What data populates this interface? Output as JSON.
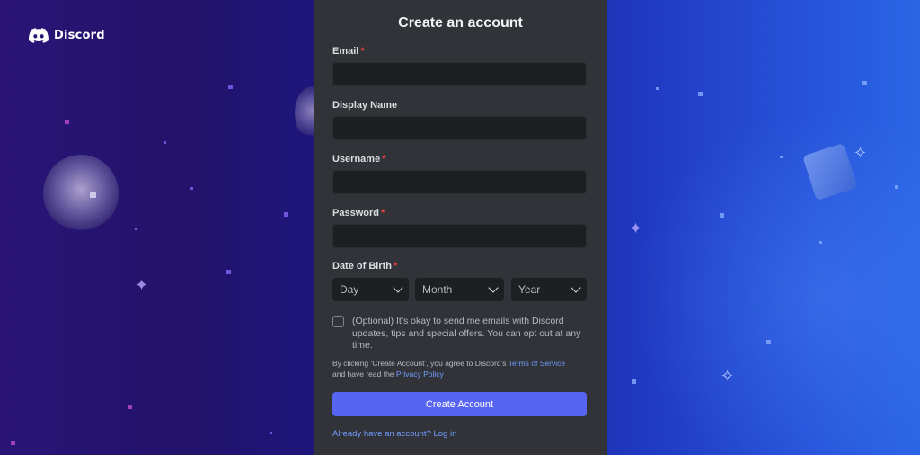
{
  "brand": {
    "name": "Discord",
    "logo_icon": "discord-clyde-icon"
  },
  "form": {
    "title": "Create an account",
    "email": {
      "label": "Email",
      "required_marker": "*",
      "value": ""
    },
    "display_name": {
      "label": "Display Name",
      "value": ""
    },
    "username": {
      "label": "Username",
      "required_marker": "*",
      "value": ""
    },
    "password": {
      "label": "Password",
      "required_marker": "*",
      "value": ""
    },
    "dob": {
      "label": "Date of Birth",
      "required_marker": "*",
      "day": "Day",
      "month": "Month",
      "year": "Year"
    },
    "optin": {
      "checked": false,
      "text": "(Optional) It’s okay to send me emails with Discord updates, tips and special offers. You can opt out at any time."
    },
    "terms": {
      "prefix": "By clicking ‘Create Account’, you agree to Discord’s ",
      "tos_link": "Terms of Service",
      "middle": "and have read the ",
      "privacy_link": "Privacy Policy"
    },
    "submit_label": "Create Account",
    "login_link": "Already have an account? Log in"
  },
  "colors": {
    "accent": "#5865f2",
    "panel": "#313338",
    "input_bg": "#1e1f22",
    "link": "#6f9cff",
    "required": "#f23f43"
  }
}
